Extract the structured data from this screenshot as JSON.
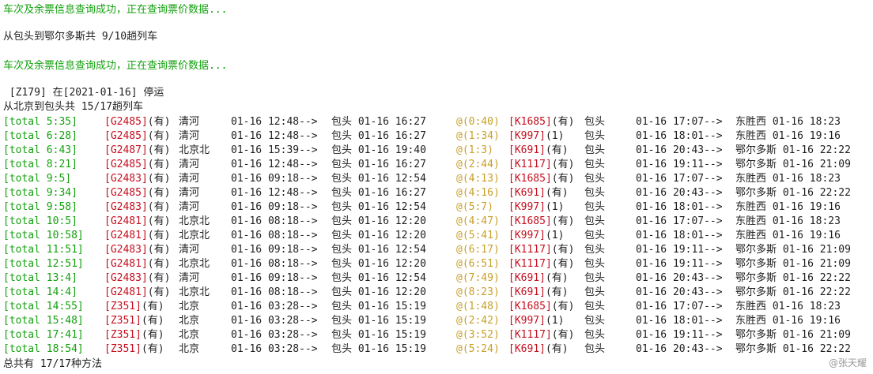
{
  "header_lines": [
    "车次及余票信息查询成功，正在查询票价数据...",
    "从包头到鄂尔多斯共 9/10趟列车",
    "车次及余票信息查询成功，正在查询票价数据...",
    " [Z179] 在[2021-01-16] 停运",
    "从北京到包头共 15/17趟列车"
  ],
  "rows": [
    {
      "total": "[total 5:35]",
      "train1": "[G2485]",
      "avail1": "(有)",
      "station1": "清河",
      "depart1": "01-16 12:48-->",
      "arrive1": "包头 01-16 16:27",
      "transfer": "@(0:40)",
      "train2": "[K1685]",
      "avail2": "(有)",
      "station2": "包头",
      "depart2": "01-16 17:07-->",
      "arrive2": "东胜西 01-16 18:23"
    },
    {
      "total": "[total 6:28]",
      "train1": "[G2485]",
      "avail1": "(有)",
      "station1": "清河",
      "depart1": "01-16 12:48-->",
      "arrive1": "包头 01-16 16:27",
      "transfer": "@(1:34)",
      "train2": "[K997]",
      "avail2": "(1)",
      "station2": "包头",
      "depart2": "01-16 18:01-->",
      "arrive2": "东胜西 01-16 19:16"
    },
    {
      "total": "[total 6:43]",
      "train1": "[G2487]",
      "avail1": "(有)",
      "station1": "北京北",
      "depart1": "01-16 15:39-->",
      "arrive1": "包头 01-16 19:40",
      "transfer": "@(1:3)",
      "train2": "[K691]",
      "avail2": "(有)",
      "station2": "包头",
      "depart2": "01-16 20:43-->",
      "arrive2": "鄂尔多斯 01-16 22:22"
    },
    {
      "total": "[total 8:21]",
      "train1": "[G2485]",
      "avail1": "(有)",
      "station1": "清河",
      "depart1": "01-16 12:48-->",
      "arrive1": "包头 01-16 16:27",
      "transfer": "@(2:44)",
      "train2": "[K1117]",
      "avail2": "(有)",
      "station2": "包头",
      "depart2": "01-16 19:11-->",
      "arrive2": "鄂尔多斯 01-16 21:09"
    },
    {
      "total": "[total 9:5]",
      "train1": "[G2483]",
      "avail1": "(有)",
      "station1": "清河",
      "depart1": "01-16 09:18-->",
      "arrive1": "包头 01-16 12:54",
      "transfer": "@(4:13)",
      "train2": "[K1685]",
      "avail2": "(有)",
      "station2": "包头",
      "depart2": "01-16 17:07-->",
      "arrive2": "东胜西 01-16 18:23"
    },
    {
      "total": "[total 9:34]",
      "train1": "[G2485]",
      "avail1": "(有)",
      "station1": "清河",
      "depart1": "01-16 12:48-->",
      "arrive1": "包头 01-16 16:27",
      "transfer": "@(4:16)",
      "train2": "[K691]",
      "avail2": "(有)",
      "station2": "包头",
      "depart2": "01-16 20:43-->",
      "arrive2": "鄂尔多斯 01-16 22:22"
    },
    {
      "total": "[total 9:58]",
      "train1": "[G2483]",
      "avail1": "(有)",
      "station1": "清河",
      "depart1": "01-16 09:18-->",
      "arrive1": "包头 01-16 12:54",
      "transfer": "@(5:7)",
      "train2": "[K997]",
      "avail2": "(1)",
      "station2": "包头",
      "depart2": "01-16 18:01-->",
      "arrive2": "东胜西 01-16 19:16"
    },
    {
      "total": "[total 10:5]",
      "train1": "[G2481]",
      "avail1": "(有)",
      "station1": "北京北",
      "depart1": "01-16 08:18-->",
      "arrive1": "包头 01-16 12:20",
      "transfer": "@(4:47)",
      "train2": "[K1685]",
      "avail2": "(有)",
      "station2": "包头",
      "depart2": "01-16 17:07-->",
      "arrive2": "东胜西 01-16 18:23"
    },
    {
      "total": "[total 10:58]",
      "train1": "[G2481]",
      "avail1": "(有)",
      "station1": "北京北",
      "depart1": "01-16 08:18-->",
      "arrive1": "包头 01-16 12:20",
      "transfer": "@(5:41)",
      "train2": "[K997]",
      "avail2": "(1)",
      "station2": "包头",
      "depart2": "01-16 18:01-->",
      "arrive2": "东胜西 01-16 19:16"
    },
    {
      "total": "[total 11:51]",
      "train1": "[G2483]",
      "avail1": "(有)",
      "station1": "清河",
      "depart1": "01-16 09:18-->",
      "arrive1": "包头 01-16 12:54",
      "transfer": "@(6:17)",
      "train2": "[K1117]",
      "avail2": "(有)",
      "station2": "包头",
      "depart2": "01-16 19:11-->",
      "arrive2": "鄂尔多斯 01-16 21:09"
    },
    {
      "total": "[total 12:51]",
      "train1": "[G2481]",
      "avail1": "(有)",
      "station1": "北京北",
      "depart1": "01-16 08:18-->",
      "arrive1": "包头 01-16 12:20",
      "transfer": "@(6:51)",
      "train2": "[K1117]",
      "avail2": "(有)",
      "station2": "包头",
      "depart2": "01-16 19:11-->",
      "arrive2": "鄂尔多斯 01-16 21:09"
    },
    {
      "total": "[total 13:4]",
      "train1": "[G2483]",
      "avail1": "(有)",
      "station1": "清河",
      "depart1": "01-16 09:18-->",
      "arrive1": "包头 01-16 12:54",
      "transfer": "@(7:49)",
      "train2": "[K691]",
      "avail2": "(有)",
      "station2": "包头",
      "depart2": "01-16 20:43-->",
      "arrive2": "鄂尔多斯 01-16 22:22"
    },
    {
      "total": "[total 14:4]",
      "train1": "[G2481]",
      "avail1": "(有)",
      "station1": "北京北",
      "depart1": "01-16 08:18-->",
      "arrive1": "包头 01-16 12:20",
      "transfer": "@(8:23)",
      "train2": "[K691]",
      "avail2": "(有)",
      "station2": "包头",
      "depart2": "01-16 20:43-->",
      "arrive2": "鄂尔多斯 01-16 22:22"
    },
    {
      "total": "[total 14:55]",
      "train1": "[Z351]",
      "avail1": "(有)",
      "station1": "北京",
      "depart1": "01-16 03:28-->",
      "arrive1": "包头 01-16 15:19",
      "transfer": "@(1:48)",
      "train2": "[K1685]",
      "avail2": "(有)",
      "station2": "包头",
      "depart2": "01-16 17:07-->",
      "arrive2": "东胜西 01-16 18:23"
    },
    {
      "total": "[total 15:48]",
      "train1": "[Z351]",
      "avail1": "(有)",
      "station1": "北京",
      "depart1": "01-16 03:28-->",
      "arrive1": "包头 01-16 15:19",
      "transfer": "@(2:42)",
      "train2": "[K997]",
      "avail2": "(1)",
      "station2": "包头",
      "depart2": "01-16 18:01-->",
      "arrive2": "东胜西 01-16 19:16"
    },
    {
      "total": "[total 17:41]",
      "train1": "[Z351]",
      "avail1": "(有)",
      "station1": "北京",
      "depart1": "01-16 03:28-->",
      "arrive1": "包头 01-16 15:19",
      "transfer": "@(3:52)",
      "train2": "[K1117]",
      "avail2": "(有)",
      "station2": "包头",
      "depart2": "01-16 19:11-->",
      "arrive2": "鄂尔多斯 01-16 21:09"
    },
    {
      "total": "[total 18:54]",
      "train1": "[Z351]",
      "avail1": "(有)",
      "station1": "北京",
      "depart1": "01-16 03:28-->",
      "arrive1": "包头 01-16 15:19",
      "transfer": "@(5:24)",
      "train2": "[K691]",
      "avail2": "(有)",
      "station2": "包头",
      "depart2": "01-16 20:43-->",
      "arrive2": "鄂尔多斯 01-16 22:22"
    }
  ],
  "footer": "总共有 17/17种方法",
  "watermark": "@张天耀",
  "colors": {
    "green": "#13a10e",
    "red": "#c50f1f",
    "gold": "#c8a02a",
    "text": "#1e1e1e"
  }
}
